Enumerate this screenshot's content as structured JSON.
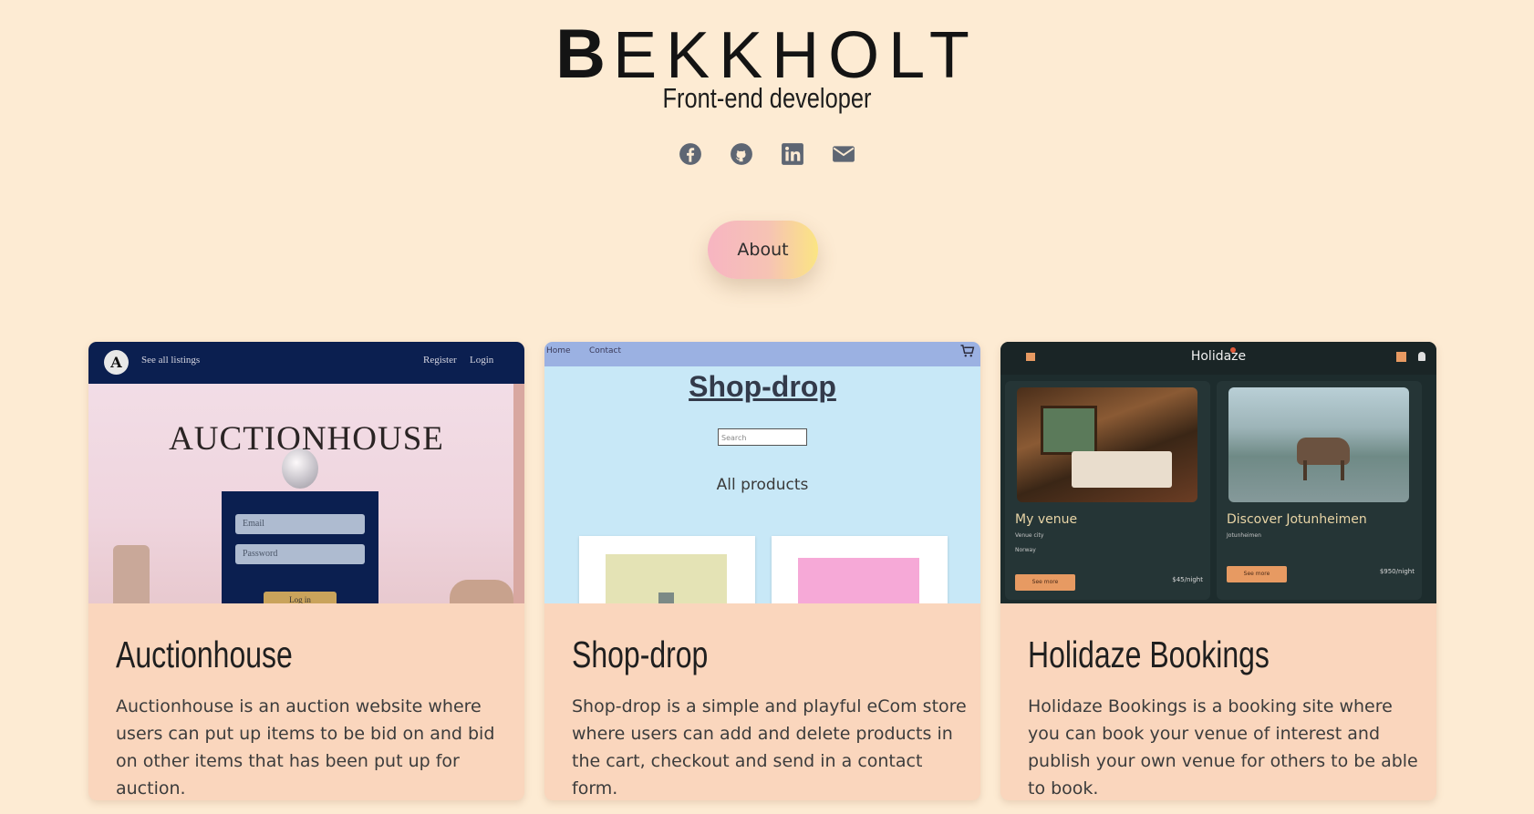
{
  "header": {
    "logo_first": "B",
    "logo_rest": "EKKHOLT",
    "tagline": "Front-end developer"
  },
  "socials": [
    {
      "name": "facebook-icon"
    },
    {
      "name": "github-icon"
    },
    {
      "name": "linkedin-icon"
    },
    {
      "name": "email-icon"
    }
  ],
  "about_button": "About",
  "projects": [
    {
      "title": "Auctionhouse",
      "description": "Auctionhouse is an auction website where users can put up items to be bid on and bid on other items that has been put up for auction.",
      "screenshot": {
        "logo_letter": "A",
        "nav_left": "See all listings",
        "nav_register": "Register",
        "nav_login": "Login",
        "hero_title": "AUCTIONHOUSE",
        "email_placeholder": "Email",
        "password_placeholder": "Password",
        "login_button": "Log in"
      }
    },
    {
      "title": "Shop-drop",
      "description": "Shop-drop is a simple and playful eCom store where users can add and delete products in the cart, checkout and send in a contact form.",
      "screenshot": {
        "nav_home": "Home",
        "nav_contact": "Contact",
        "hero_title": "Shop-drop",
        "search_placeholder": "Search",
        "subtitle": "All products"
      }
    },
    {
      "title": "Holidaze Bookings",
      "description": "Holidaze Bookings is a booking site where you can book your venue of interest and publish your own venue for others to be able to book.",
      "screenshot": {
        "brand": "Holidaze",
        "venue1_name": "My venue",
        "venue1_city": "Venue city",
        "venue1_country": "Norway",
        "venue1_button": "See more",
        "venue1_price": "$45/night",
        "venue2_name": "Discover Jotunheimen",
        "venue2_city": "Jotunheimen",
        "venue2_button": "See more",
        "venue2_price": "$950/night"
      }
    }
  ],
  "colors": {
    "background": "#fdebd3",
    "card": "#fad6bd",
    "icon": "#5e6673"
  }
}
